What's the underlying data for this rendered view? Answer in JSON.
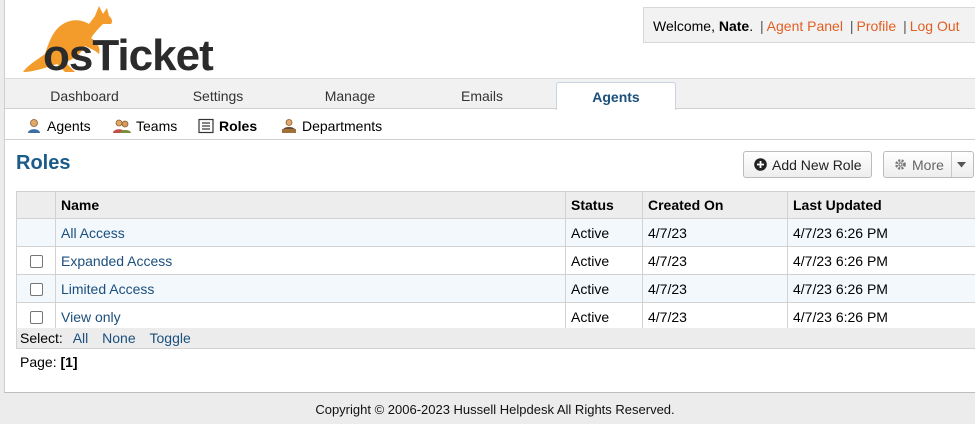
{
  "brand": {
    "logo_text": "osTicket",
    "colors": {
      "logo_orange": "#f39c2c",
      "logo_text": "#222222",
      "link": "#1b4f7d",
      "header_link": "#e25f24"
    }
  },
  "header": {
    "welcome_label": "Welcome,",
    "user_name": "Nate",
    "links": [
      "Agent Panel",
      "Profile",
      "Log Out"
    ]
  },
  "nav": {
    "tabs": [
      "Dashboard",
      "Settings",
      "Manage",
      "Emails",
      "Agents"
    ],
    "active_tab": "Agents"
  },
  "subnav": {
    "items": [
      {
        "label": "Agents",
        "icon": "agent-icon"
      },
      {
        "label": "Teams",
        "icon": "teams-icon"
      },
      {
        "label": "Roles",
        "icon": "roles-icon"
      },
      {
        "label": "Departments",
        "icon": "departments-icon"
      }
    ],
    "active_item": "Roles"
  },
  "page": {
    "title": "Roles",
    "add_button": "Add New Role",
    "more_button": "More"
  },
  "table": {
    "columns": [
      "Name",
      "Status",
      "Created On",
      "Last Updated"
    ],
    "rows": [
      {
        "name": "All Access",
        "status": "Active",
        "created": "4/7/23",
        "updated": "4/7/23 6:26 PM",
        "checkbox": false
      },
      {
        "name": "Expanded Access",
        "status": "Active",
        "created": "4/7/23",
        "updated": "4/7/23 6:26 PM",
        "checkbox": true
      },
      {
        "name": "Limited Access",
        "status": "Active",
        "created": "4/7/23",
        "updated": "4/7/23 6:26 PM",
        "checkbox": true
      },
      {
        "name": "View only",
        "status": "Active",
        "created": "4/7/23",
        "updated": "4/7/23 6:26 PM",
        "checkbox": true
      }
    ]
  },
  "select_bar": {
    "label": "Select:",
    "options": [
      "All",
      "None",
      "Toggle"
    ]
  },
  "pager": {
    "label": "Page:",
    "current": "[1]"
  },
  "footer": {
    "copyright": "Copyright © 2006-2023 Hussell Helpdesk All Rights Reserved."
  }
}
